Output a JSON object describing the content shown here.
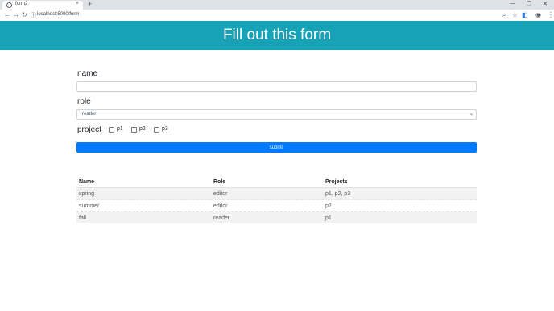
{
  "browser": {
    "tab_title": "form2",
    "tab_close": "×",
    "new_tab": "+",
    "url": "localhost:5000/form",
    "window_controls": [
      "—",
      "❐",
      "✕"
    ],
    "nav": [
      "←",
      "→",
      "↻"
    ]
  },
  "header": {
    "title": "Fill out this form"
  },
  "form": {
    "name_label": "name",
    "name_value": "",
    "role_label": "role",
    "role_selected": "reader",
    "project_label": "project",
    "projects": [
      "p1",
      "p2",
      "p3"
    ],
    "submit_label": "submit"
  },
  "table": {
    "headers": [
      "Name",
      "Role",
      "Projects"
    ],
    "rows": [
      [
        "spring",
        "editor",
        "p1, p2, p3"
      ],
      [
        "summer",
        "editor",
        "p2"
      ],
      [
        "fall",
        "reader",
        "p1"
      ]
    ]
  }
}
